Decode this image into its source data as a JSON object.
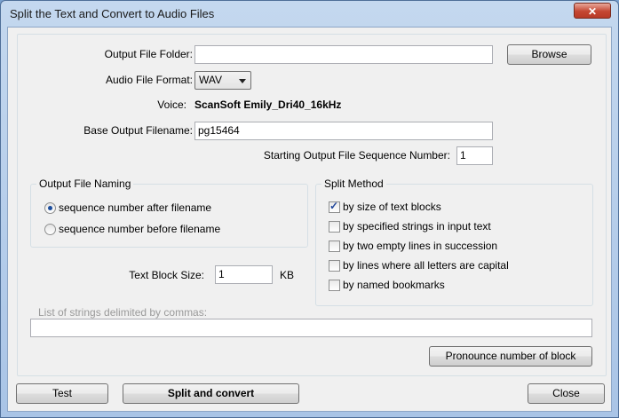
{
  "window": {
    "title": "Split the Text and Convert to Audio Files",
    "close_glyph": "✕"
  },
  "form": {
    "output_folder_label": "Output File Folder:",
    "output_folder_value": "",
    "browse_label": "Browse",
    "audio_format_label": "Audio File Format:",
    "audio_format_value": "WAV",
    "voice_label": "Voice:",
    "voice_value": "ScanSoft Emily_Dri40_16kHz",
    "base_filename_label": "Base Output Filename:",
    "base_filename_value": "pg15464",
    "start_seq_label": "Starting Output File Sequence Number:",
    "start_seq_value": "1",
    "block_size_label": "Text Block Size:",
    "block_size_value": "1",
    "block_size_unit": "KB",
    "strings_label": "List of strings delimited by commas:",
    "strings_value": ""
  },
  "naming": {
    "title": "Output File Naming",
    "options": [
      {
        "label": "sequence number after filename",
        "selected": true
      },
      {
        "label": "sequence number before filename",
        "selected": false
      }
    ]
  },
  "split": {
    "title": "Split Method",
    "options": [
      {
        "label": "by size of text blocks",
        "checked": true
      },
      {
        "label": "by specified strings in input text",
        "checked": false
      },
      {
        "label": "by two empty lines in succession",
        "checked": false
      },
      {
        "label": "by lines where all letters are capital",
        "checked": false
      },
      {
        "label": "by named bookmarks",
        "checked": false
      }
    ]
  },
  "buttons": {
    "pronounce": "Pronounce number of block",
    "test": "Test",
    "split_convert": "Split and convert",
    "close": "Close"
  }
}
